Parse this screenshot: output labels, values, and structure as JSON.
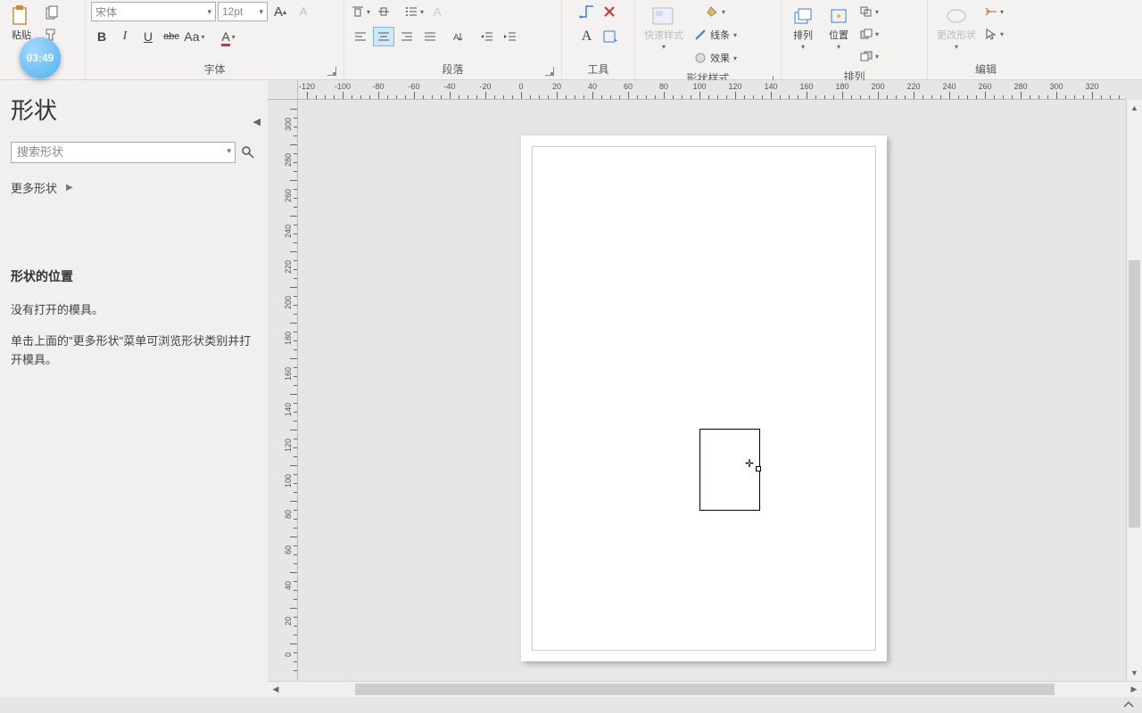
{
  "time_badge": "03:49",
  "ribbon": {
    "clipboard": {
      "paste": "粘贴",
      "label": ""
    },
    "font": {
      "font_name": "宋体",
      "font_size": "12pt",
      "label": "字体",
      "bold": "B",
      "italic": "I",
      "underline": "U",
      "strike": "abc",
      "case": "Aa"
    },
    "paragraph": {
      "label": "段落"
    },
    "tools": {
      "label": "工具",
      "text": "A"
    },
    "shape_style": {
      "label": "形状样式",
      "quick": "快速样式",
      "line": "线条",
      "effect": "效果"
    },
    "arrange": {
      "label": "排列",
      "button1": "排列",
      "button2": "位置"
    },
    "edit": {
      "label": "编辑",
      "change_shape": "更改形状"
    }
  },
  "panel": {
    "title": "形状",
    "search_placeholder": "搜索形状",
    "more_shapes": "更多形状",
    "heading": "形状的位置",
    "msg1": "没有打开的模具。",
    "msg2": "单击上面的\"更多形状\"菜单可浏览形状类别并打开模具。"
  },
  "ruler": {
    "h": [
      "-120",
      "-100",
      "-80",
      "-60",
      "-40",
      "-20",
      "0",
      "20",
      "40",
      "60",
      "80",
      "100",
      "120",
      "140",
      "160",
      "180",
      "200",
      "220",
      "240",
      "260",
      "280",
      "300",
      "320"
    ],
    "v": [
      "300",
      "280",
      "260",
      "240",
      "220",
      "200",
      "180",
      "160",
      "140",
      "120",
      "100",
      "80",
      "60",
      "40",
      "20",
      "0"
    ]
  }
}
